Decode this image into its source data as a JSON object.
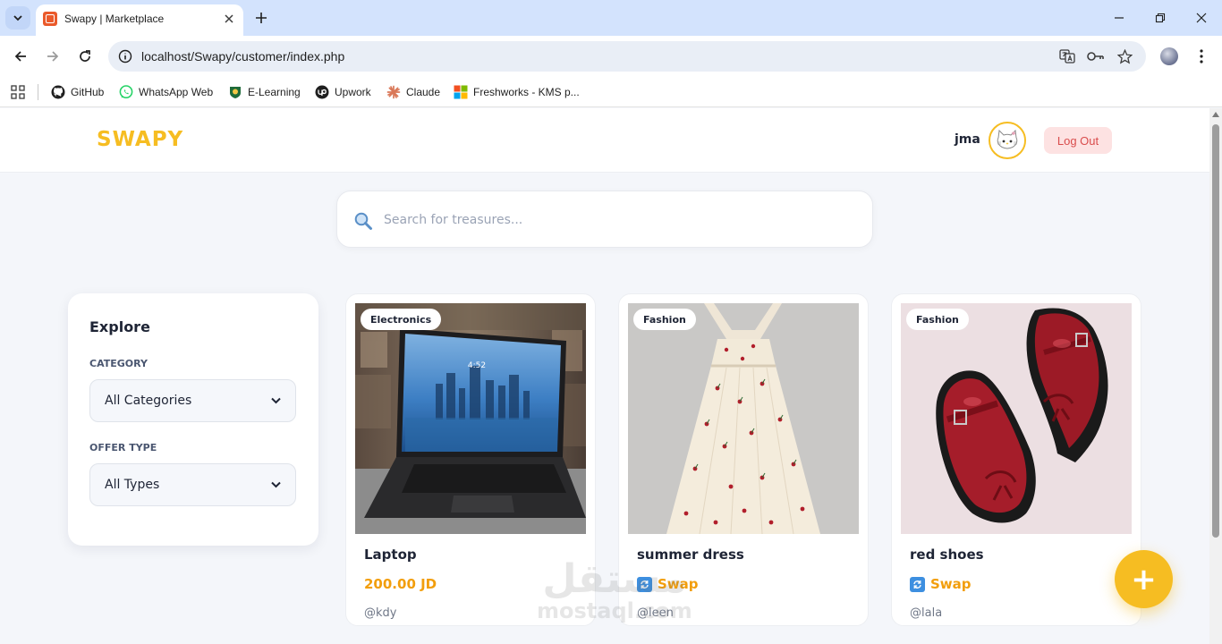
{
  "browser": {
    "tab_title": "Swapy | Marketplace",
    "url": "localhost/Swapy/customer/index.php",
    "bookmarks": [
      {
        "label": "GitHub",
        "icon": "github-icon"
      },
      {
        "label": "WhatsApp Web",
        "icon": "whatsapp-icon"
      },
      {
        "label": "E-Learning",
        "icon": "elearning-icon"
      },
      {
        "label": "Upwork",
        "icon": "upwork-icon"
      },
      {
        "label": "Claude",
        "icon": "claude-icon"
      },
      {
        "label": "Freshworks - KMS p...",
        "icon": "microsoft-icon"
      }
    ]
  },
  "header": {
    "logo": "SWAPY",
    "username": "jma",
    "logout_label": "Log Out"
  },
  "search": {
    "placeholder": "Search for treasures..."
  },
  "filters": {
    "title": "Explore",
    "category_label": "CATEGORY",
    "category_value": "All Categories",
    "offer_label": "OFFER TYPE",
    "offer_value": "All Types"
  },
  "products": [
    {
      "category": "Electronics",
      "title": "Laptop",
      "price": "200.00 JD",
      "user": "@kdy",
      "offer": "price",
      "image": "laptop-image"
    },
    {
      "category": "Fashion",
      "title": "summer dress",
      "price": "Swap",
      "user": "@leen",
      "offer": "swap",
      "image": "dress-image"
    },
    {
      "category": "Fashion",
      "title": "red shoes",
      "price": "Swap",
      "user": "@lala",
      "offer": "swap",
      "image": "shoes-image"
    }
  ],
  "fab_label": "+",
  "watermark": {
    "arabic": "مستقل",
    "latin": "mostaql.com"
  },
  "colors": {
    "brand": "#f6bd22",
    "price": "#f29e0c",
    "logout_text": "#d94c4c",
    "logout_bg": "#fde2e2",
    "swap_icon": "#3d8fe0"
  }
}
